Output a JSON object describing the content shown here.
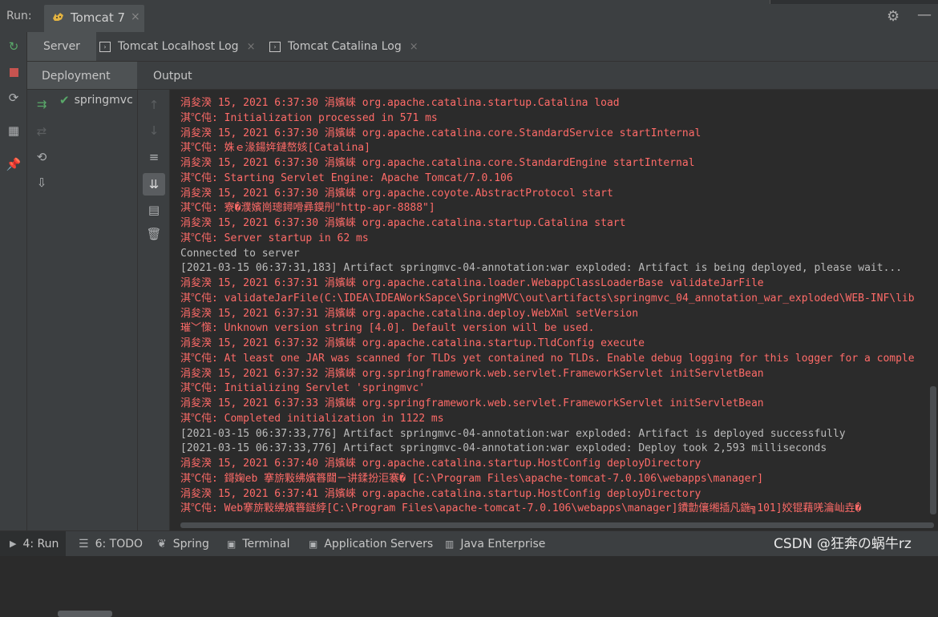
{
  "run": {
    "label": "Run:",
    "tab_title": "Tomcat 7",
    "close": "×"
  },
  "sub_tabs": [
    {
      "label": "Server"
    },
    {
      "label": "Tomcat Localhost Log",
      "close": "×"
    },
    {
      "label": "Tomcat Catalina Log",
      "close": "×"
    }
  ],
  "panels": {
    "deployment": "Deployment",
    "output": "Output"
  },
  "deployment_item": "springmvc",
  "console": {
    "lines": [
      {
        "text": "涓夋湀 15, 2021 6:37:30 涓嬪崍 org.apache.catalina.startup.Catalina load",
        "type": "err"
      },
      {
        "text": "淇℃伅: Initialization processed in 571 ms",
        "type": "err"
      },
      {
        "text": "涓夋湀 15, 2021 6:37:30 涓嬪崍 org.apache.catalina.core.StandardService startInternal",
        "type": "err"
      },
      {
        "text": "淇℃伅: 姝ｅ湪鍚姩鏈嶅姟[Catalina]",
        "type": "err"
      },
      {
        "text": "涓夋湀 15, 2021 6:37:30 涓嬪崍 org.apache.catalina.core.StandardEngine startInternal",
        "type": "err"
      },
      {
        "text": "淇℃伅: Starting Servlet Engine: Apache Tomcat/7.0.106",
        "type": "err"
      },
      {
        "text": "涓夋湀 15, 2021 6:37:30 涓嬪崍 org.apache.coyote.AbstractProtocol start",
        "type": "err"
      },
      {
        "text": "淇℃伅: 寮�濮嬪崗璁鐞嗗彞鏌刐\"http-apr-8888\"]",
        "type": "err"
      },
      {
        "text": "涓夋湀 15, 2021 6:37:30 涓嬪崍 org.apache.catalina.startup.Catalina start",
        "type": "err"
      },
      {
        "text": "淇℃伅: Server startup in 62 ms",
        "type": "err"
      },
      {
        "text": "Connected to server",
        "type": "std"
      },
      {
        "text": "[2021-03-15 06:37:31,183] Artifact springmvc-04-annotation:war exploded: Artifact is being deployed, please wait...",
        "type": "std"
      },
      {
        "text": "涓夋湀 15, 2021 6:37:31 涓嬪崍 org.apache.catalina.loader.WebappClassLoaderBase validateJarFile",
        "type": "err"
      },
      {
        "text": "淇℃伅: validateJarFile(C:\\IDEA\\IDEAWorkSapce\\SpringMVC\\out\\artifacts\\springmvc_04_annotation_war_exploded\\WEB-INF\\lib",
        "type": "err"
      },
      {
        "text": "涓夋湀 15, 2021 6:37:31 涓嬪崍 org.apache.catalina.deploy.WebXml setVersion",
        "type": "err"
      },
      {
        "text": "璀﹀憡: Unknown version string [4.0]. Default version will be used.",
        "type": "err"
      },
      {
        "text": "涓夋湀 15, 2021 6:37:32 涓嬪崍 org.apache.catalina.startup.TldConfig execute",
        "type": "err"
      },
      {
        "text": "淇℃伅: At least one JAR was scanned for TLDs yet contained no TLDs. Enable debug logging for this logger for a comple",
        "type": "err"
      },
      {
        "text": "涓夋湀 15, 2021 6:37:32 涓嬪崍 org.springframework.web.servlet.FrameworkServlet initServletBean",
        "type": "err"
      },
      {
        "text": "淇℃伅: Initializing Servlet 'springmvc'",
        "type": "err"
      },
      {
        "text": "涓夋湀 15, 2021 6:37:33 涓嬪崍 org.springframework.web.servlet.FrameworkServlet initServletBean",
        "type": "err"
      },
      {
        "text": "淇℃伅: Completed initialization in 1122 ms",
        "type": "err"
      },
      {
        "text": "[2021-03-15 06:37:33,776] Artifact springmvc-04-annotation:war exploded: Artifact is deployed successfully",
        "type": "std"
      },
      {
        "text": "[2021-03-15 06:37:33,776] Artifact springmvc-04-annotation:war exploded: Deploy took 2,593 milliseconds",
        "type": "std"
      },
      {
        "text": "涓夋湀 15, 2021 6:37:40 涓嬪崍 org.apache.catalina.startup.HostConfig deployDirectory",
        "type": "err"
      },
      {
        "text": "淇℃伅: 鎶婅eb 搴旂敤绋嬪簭閮ㄧ讲鍒扮洰褰� [C:\\Program Files\\apache-tomcat-7.0.106\\webapps\\manager]",
        "type": "err"
      },
      {
        "text": "涓夋湀 15, 2021 6:37:41 涓嬪崍 org.apache.catalina.startup.HostConfig deployDirectory",
        "type": "err"
      },
      {
        "text": "淇℃伅: Web搴旂敤绋嬪簭鐩綍[C:\\Program Files\\apache-tomcat-7.0.106\\webapps\\manager]鐨勯儴缃插凡鍦╗101]姣锟藉唴瀹屾垚�",
        "type": "err"
      }
    ]
  },
  "bottom_tabs": [
    {
      "label": "4: Run",
      "icon": "run-icon"
    },
    {
      "label": "6: TODO",
      "icon": "todo-icon"
    },
    {
      "label": "Spring",
      "icon": "spring-icon"
    },
    {
      "label": "Terminal",
      "icon": "terminal-icon"
    },
    {
      "label": "Application Servers",
      "icon": "servers-icon"
    },
    {
      "label": "Java Enterprise",
      "icon": "java-ee-icon"
    }
  ],
  "watermark": "CSDN @狂奔の蜗牛rz",
  "colors": {
    "error_text": "#ff6b68",
    "normal_text": "#bbbbbb",
    "accent_green": "#59a869",
    "accent_red": "#c75450"
  }
}
